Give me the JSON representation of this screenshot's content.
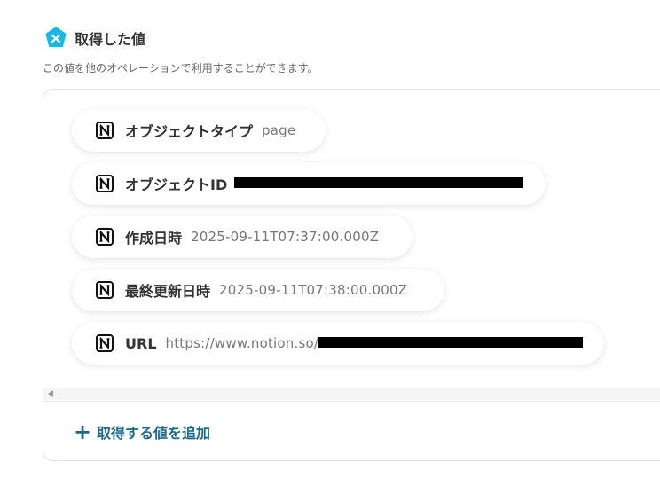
{
  "header": {
    "title": "取得した値",
    "icon": "yoom-hexagon-icon",
    "icon_color": "#19b7e6"
  },
  "subtitle": "この値を他のオペレーションで利用することができます。",
  "items": [
    {
      "icon": "notion-icon",
      "label": "オブジェクトタイプ",
      "value": "page"
    },
    {
      "icon": "notion-icon",
      "label": "オブジェクトID",
      "value": ""
    },
    {
      "icon": "notion-icon",
      "label": "作成日時",
      "value": "2025-09-11T07:37:00.000Z"
    },
    {
      "icon": "notion-icon",
      "label": "最終更新日時",
      "value": "2025-09-11T07:38:00.000Z"
    },
    {
      "icon": "notion-icon",
      "label": "URL",
      "value": "https://www.notion.so/"
    }
  ],
  "add_button": {
    "icon": "plus-icon",
    "label": "取得する値を追加",
    "color": "#1e6a86"
  }
}
